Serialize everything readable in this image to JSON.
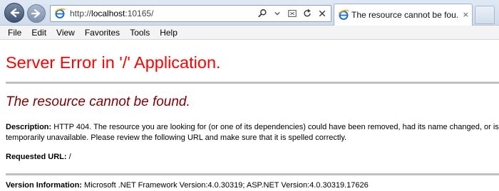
{
  "browser": {
    "address_url_prefix": "http://",
    "address_url_host": "localhost",
    "address_url_rest": ":10165/",
    "tab_title": "The resource cannot be fou...",
    "tab_close": "×",
    "icons": {
      "back": "back-arrow-icon",
      "forward": "forward-arrow-icon",
      "search": "search-icon",
      "compat": "compatibility-view-icon",
      "refresh": "refresh-icon",
      "close_addr": "close-icon",
      "page": "ie-page-icon"
    }
  },
  "menu": {
    "file": "File",
    "edit": "Edit",
    "view": "View",
    "favorites": "Favorites",
    "tools": "Tools",
    "help": "Help"
  },
  "page": {
    "server_error_title": "Server Error in '/' Application.",
    "not_found_heading": "The resource cannot be found.",
    "description_label": "Description:",
    "description_text": "HTTP 404. The resource you are looking for (or one of its dependencies) could have been removed, had its name changed, or is temporarily unavailable.  Please review the following URL and make sure that it is spelled correctly.",
    "requested_url_label": "Requested URL:",
    "requested_url_value": "/",
    "version_label": "Version Information:",
    "version_text": "Microsoft .NET Framework Version:4.0.30319; ASP.NET Version:4.0.30319.17626"
  },
  "colors": {
    "server_error": "#ff0000",
    "not_found": "#800000",
    "rule": "#c0c0c0"
  }
}
